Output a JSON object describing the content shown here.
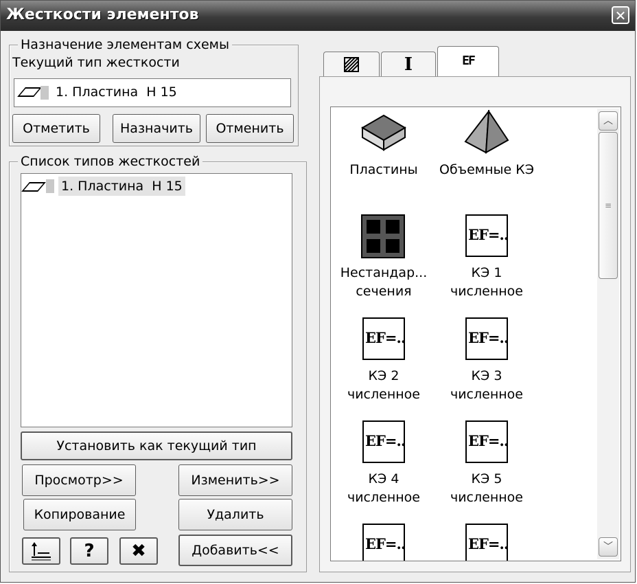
{
  "window": {
    "title": "Жесткости элементов",
    "close_glyph": "✕"
  },
  "assign_group": {
    "legend": "Назначение элементам схемы",
    "current_label": "Текущий тип жесткости",
    "current_value": "1. Пластина  Н 15",
    "buttons": {
      "mark": "Отметить",
      "assign": "Назначить",
      "cancel": "Отменить"
    }
  },
  "list_group": {
    "legend": "Список типов жесткостей",
    "items": [
      {
        "label": "1. Пластина  Н 15",
        "icon": "plate-icon"
      }
    ],
    "set_current": "Установить как текущий тип",
    "view": "Просмотр>>",
    "edit": "Изменить>>",
    "copy": "Копирование",
    "delete": "Удалить",
    "add": "Добавить<<",
    "bottom_icons": {
      "help": "?",
      "close": "✖"
    }
  },
  "tabs": [
    {
      "name": "hatch-tab",
      "glyph": "▨"
    },
    {
      "name": "ibeam-tab",
      "glyph": "I"
    },
    {
      "name": "ef-tab",
      "glyph": "EF"
    }
  ],
  "palette": {
    "items": [
      {
        "label": "Пластины",
        "icon": "plate-3d-icon"
      },
      {
        "label": "Объемные КЭ",
        "icon": "pyramid-icon"
      },
      {
        "label": "Нестандар...\nсечения",
        "icon": "nonstandard-section-icon"
      },
      {
        "label": "КЭ 1\nчисленное",
        "icon": "ef-icon"
      },
      {
        "label": "КЭ 2\nчисленное",
        "icon": "ef-icon"
      },
      {
        "label": "КЭ 3\nчисленное",
        "icon": "ef-icon"
      },
      {
        "label": "КЭ 4\nчисленное",
        "icon": "ef-icon"
      },
      {
        "label": "КЭ 5\nчисленное",
        "icon": "ef-icon"
      },
      {
        "label": "",
        "icon": "ef-icon"
      },
      {
        "label": "",
        "icon": "ef-icon"
      }
    ],
    "ef_text": "EF=..."
  },
  "scroll": {
    "up": "︿",
    "down": "﹀",
    "grip": "≡"
  }
}
